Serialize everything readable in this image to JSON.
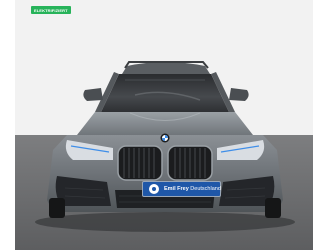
{
  "badge": {
    "label": "ELEKTRIFIZIERT",
    "color": "#27b35a"
  },
  "dealer_plate": {
    "name_bold": "Emil Frey",
    "name_rest": "Deutschland",
    "color": "#1f57a8"
  },
  "vehicle": {
    "paint_color": "#6e7378",
    "grille_color": "#1b1c1e",
    "headlight_accent": "#3f8ee8"
  },
  "scene": {
    "wall_color": "#f2f2f2",
    "floor_color": "#8f9092"
  }
}
